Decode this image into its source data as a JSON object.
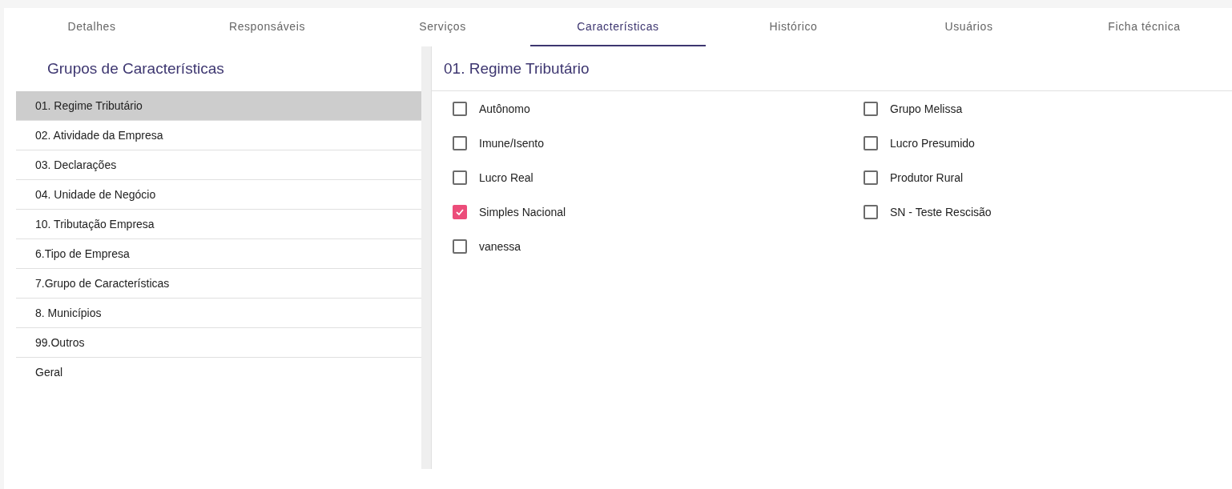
{
  "tabs": [
    {
      "label": "Detalhes",
      "selected": false
    },
    {
      "label": "Responsáveis",
      "selected": false
    },
    {
      "label": "Serviços",
      "selected": false
    },
    {
      "label": "Características",
      "selected": true
    },
    {
      "label": "Histórico",
      "selected": false
    },
    {
      "label": "Usuários",
      "selected": false
    },
    {
      "label": "Ficha técnica",
      "selected": false
    }
  ],
  "groups_panel": {
    "title": "Grupos de Características",
    "items": [
      {
        "label": "01. Regime Tributário",
        "selected": true
      },
      {
        "label": "02. Atividade da Empresa",
        "selected": false
      },
      {
        "label": "03. Declarações",
        "selected": false
      },
      {
        "label": "04. Unidade de Negócio",
        "selected": false
      },
      {
        "label": "10. Tributação Empresa",
        "selected": false
      },
      {
        "label": "6.Tipo de Empresa",
        "selected": false
      },
      {
        "label": "7.Grupo de Características",
        "selected": false
      },
      {
        "label": "8. Municípios",
        "selected": false
      },
      {
        "label": "99.Outros",
        "selected": false
      },
      {
        "label": "Geral",
        "selected": false
      }
    ]
  },
  "detail_panel": {
    "title": "01. Regime Tributário",
    "options": [
      {
        "label": "Autônomo",
        "checked": false
      },
      {
        "label": "Grupo Melissa",
        "checked": false
      },
      {
        "label": "Imune/Isento",
        "checked": false
      },
      {
        "label": "Lucro Presumido",
        "checked": false
      },
      {
        "label": "Lucro Real",
        "checked": false
      },
      {
        "label": "Produtor Rural",
        "checked": false
      },
      {
        "label": "Simples Nacional",
        "checked": true
      },
      {
        "label": "SN - Teste Rescisão",
        "checked": false
      },
      {
        "label": "vanessa",
        "checked": false
      }
    ]
  }
}
